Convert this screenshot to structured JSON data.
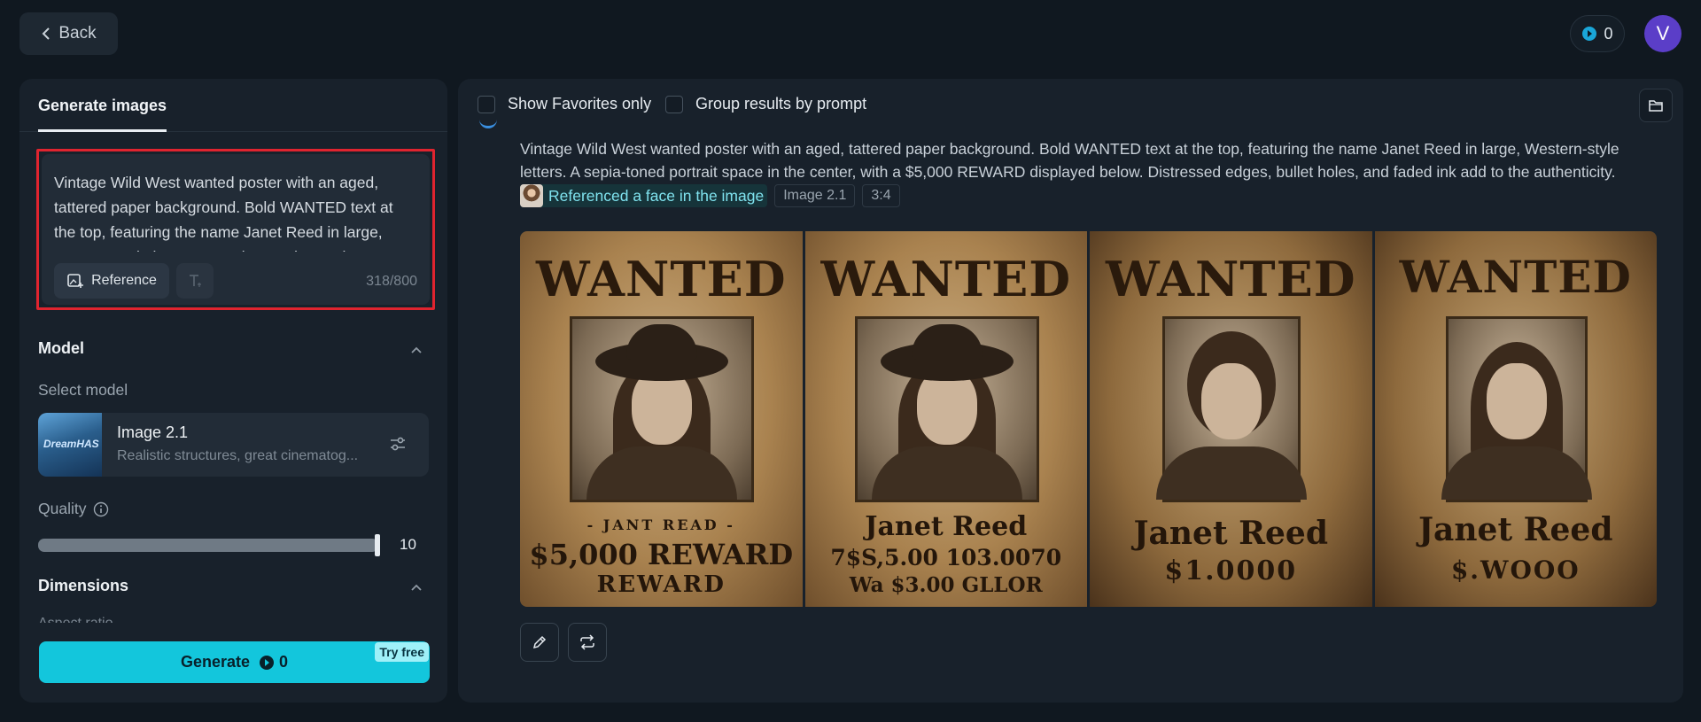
{
  "header": {
    "back_label": "Back",
    "credits": "0",
    "avatar_initial": "V"
  },
  "sidebar": {
    "tab": "Generate images",
    "prompt_text": "Vintage Wild West wanted poster with an aged, tattered paper background. Bold WANTED text at the top, featuring the name Janet Reed in large, Western-style letters. A sepia-toned portrait space in the center, with a $5,000 REWARD displayed below. Distressed edges, bullet holes, and faded ink add to the authenticity.",
    "reference_label": "Reference",
    "char_count": "318/800",
    "model_section": "Model",
    "select_model_label": "Select model",
    "model_thumb_text": "DreamHAS",
    "model_name": "Image 2.1",
    "model_desc": "Realistic structures, great cinematog...",
    "quality_label": "Quality",
    "quality_value": "10",
    "quality_fraction": 1.0,
    "dimensions_section": "Dimensions",
    "aspect_label_cut": "Aspect ratio",
    "generate_label": "Generate",
    "generate_credits": "0",
    "try_free": "Try free"
  },
  "results": {
    "show_favorites": "Show Favorites only",
    "group_by_prompt": "Group results by prompt",
    "prompt": "Vintage Wild West wanted poster with an aged, tattered paper background. Bold WANTED text at the top, featuring the name Janet Reed in large, Western-style letters. A sepia-toned portrait space in the center, with a $5,000 REWARD displayed below. Distressed edges, bullet holes, and faded ink add to the authenticity.",
    "face_chip": "Referenced a face in the image",
    "model_tag": "Image 2.1",
    "ratio_tag": "3:4",
    "posters": [
      {
        "title": "WANTED",
        "line1": "- JANT READ -",
        "line2": "$5,000 REWARD",
        "line3": "REWARD"
      },
      {
        "title": "WANTED",
        "line1": "Janet Reed",
        "line2": "7$S,5.00 103.0070",
        "line3": "Wa $3.00 GLLOR"
      },
      {
        "title": "WANTED",
        "line1": "Janet Reed",
        "line2": "$1.0000",
        "line3": ""
      },
      {
        "title": "WANTED",
        "line1": "Janet Reed",
        "line2": "$.WOOO",
        "line3": ""
      }
    ]
  },
  "colors": {
    "background": "#101820",
    "panel": "#18212b",
    "accent": "#13c6dc",
    "highlight_border": "#e0242f",
    "avatar": "#5b3ec8"
  }
}
